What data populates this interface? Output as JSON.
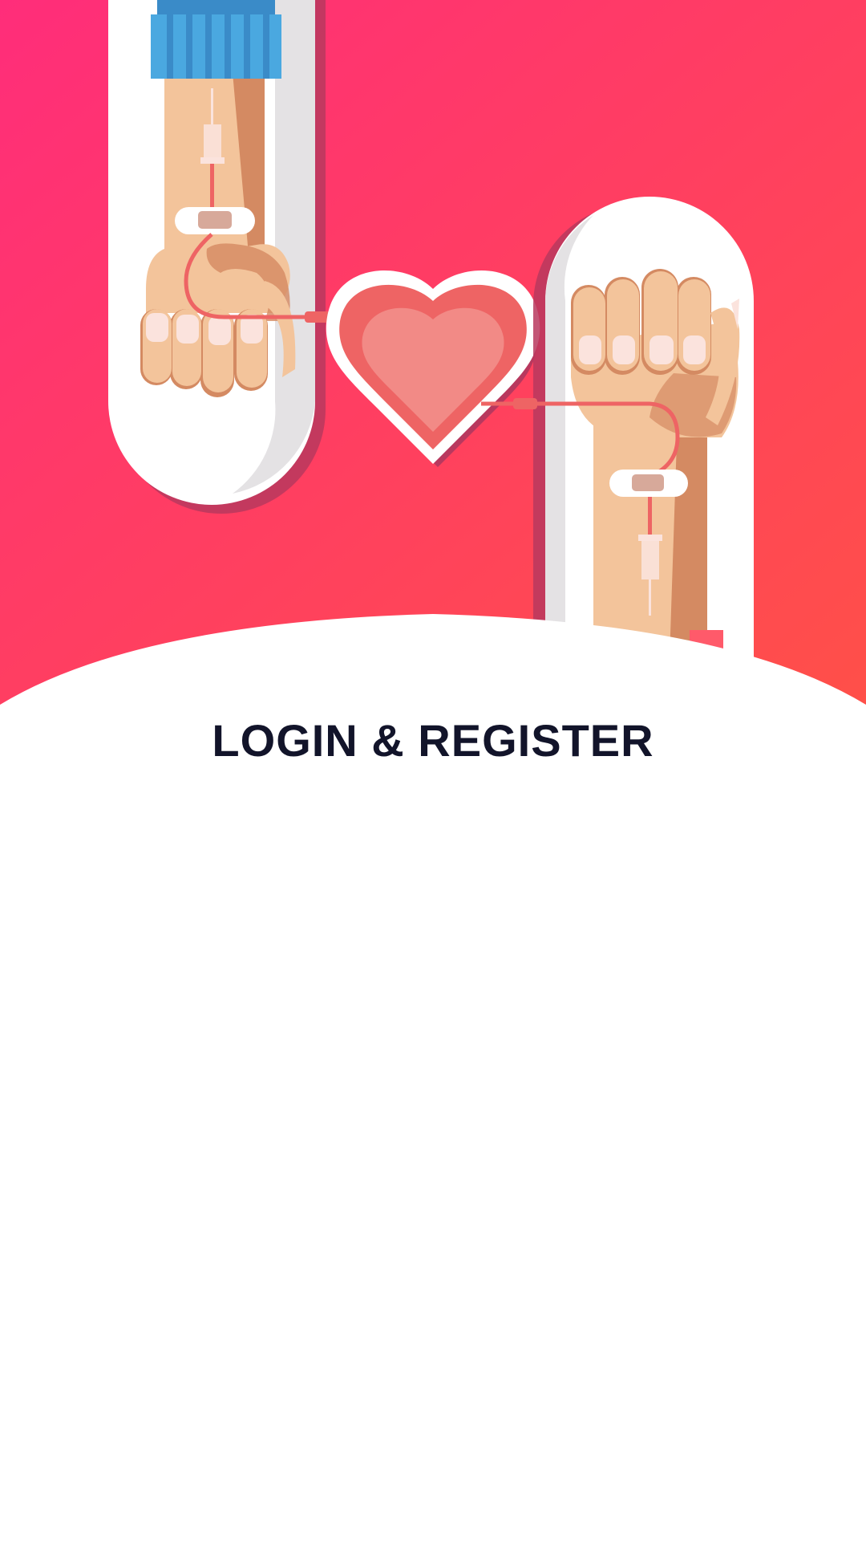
{
  "screen": {
    "title": "LOGIN & REGISTER"
  },
  "hero": {
    "illustration": "blood-donation-illustration",
    "icons": [
      "heart-icon",
      "blood-bag-icon",
      "syringe-icon",
      "bandage-icon",
      "fist-icon"
    ]
  },
  "colors": {
    "gradient_start": "#FF2D7A",
    "gradient_end": "#FF5048",
    "title": "#12142A",
    "background": "#FFFFFF",
    "heart_outer": "#EE6464",
    "heart_inner": "#F28A86",
    "skin": "#F3C49B",
    "skin_shadow": "#D48A62",
    "cuff": "#4AA8E0"
  }
}
